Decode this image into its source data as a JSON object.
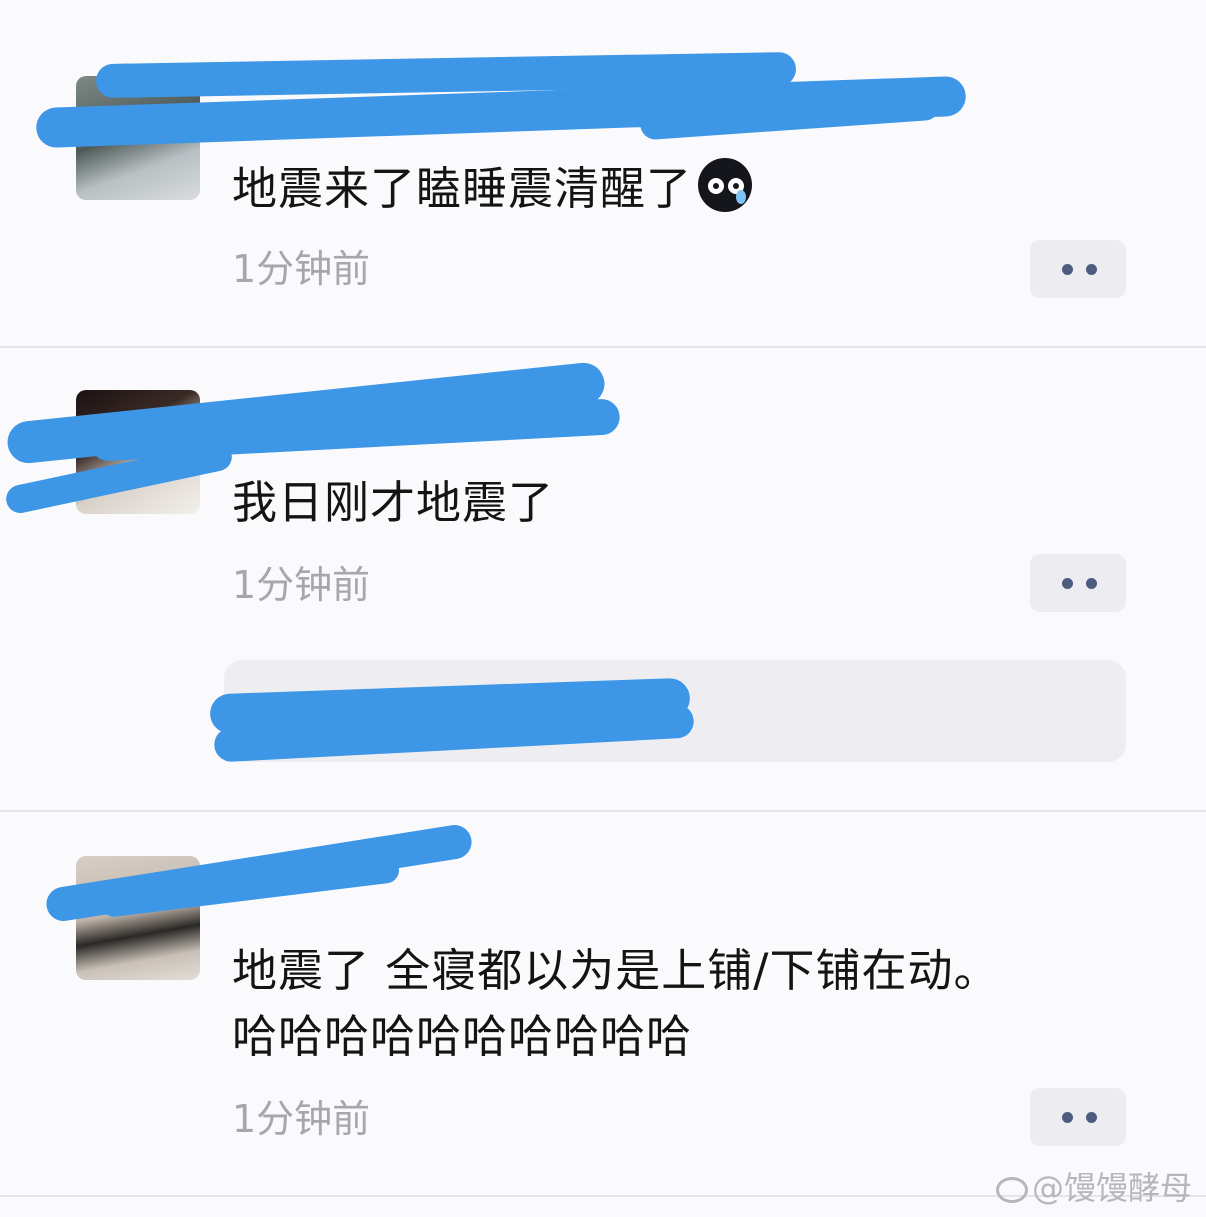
{
  "posts": [
    {
      "comment": "地震来了瞌睡震清醒了",
      "emoji": "crying-face-emoji",
      "time": "1分钟前"
    },
    {
      "comment": "我日刚才地震了",
      "time": "1分钟前"
    },
    {
      "comment_line1": "地震了 全寝都以为是上铺/下铺在动。",
      "comment_line2": "哈哈哈哈哈哈哈哈哈哈",
      "time": "1分钟前"
    }
  ],
  "watermark": "@馒馒酵母",
  "colors": {
    "background": "#fafafc",
    "redaction": "#3e96e6",
    "time_text": "#a6a6ab",
    "more_dots": "#4e5c80"
  }
}
